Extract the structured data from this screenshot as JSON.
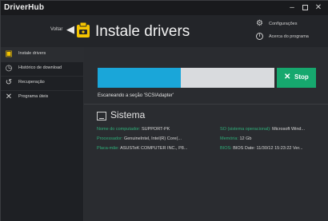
{
  "app": {
    "title": "DriverHub",
    "window_controls": {
      "minimize": "–",
      "maximize": "",
      "close": "✕"
    }
  },
  "header": {
    "back_label": "Voltar",
    "back_icon": "arrow-left-icon",
    "page_icon": "driver-install-icon",
    "title": "Instale drivers",
    "settings_label": "Configurações",
    "about_label": "Acerca do programa"
  },
  "sidebar": {
    "items": [
      {
        "label": "Instale drivers",
        "icon": "install-drivers-icon",
        "active": true
      },
      {
        "label": "Histórico de download",
        "icon": "history-clock-icon",
        "active": false
      },
      {
        "label": "Recuperação",
        "icon": "recovery-icon",
        "active": false
      },
      {
        "label": "Programa úteis",
        "icon": "tools-icon",
        "active": false
      }
    ]
  },
  "scan": {
    "progress": 0.47,
    "stop_label": "Stop",
    "status_text": "Escaneando a seção 'SCSIAdapter'"
  },
  "system": {
    "title": "Sistema",
    "left": [
      {
        "key": "Nome do computador:",
        "value": "SUPPORT-PK"
      },
      {
        "key": "Processador:",
        "value": "GenuineIntel, Intel(R) Core(..."
      },
      {
        "key": "Placa-mãe:",
        "value": "ASUSTeK COMPUTER INC., P8..."
      }
    ],
    "right": [
      {
        "key": "SO (sistema operacional):",
        "value": "Microsoft Wind..."
      },
      {
        "key": "Memória:",
        "value": "12 Gb"
      },
      {
        "key": "BIOS:",
        "value": "BIOS Date: 11/30/12 15:23:22 Ver..."
      }
    ]
  },
  "colors": {
    "accent_yellow": "#f5c400",
    "progress_blue": "#1aa6d9",
    "stop_green": "#16a86e",
    "info_key_green": "#2fb07a"
  }
}
